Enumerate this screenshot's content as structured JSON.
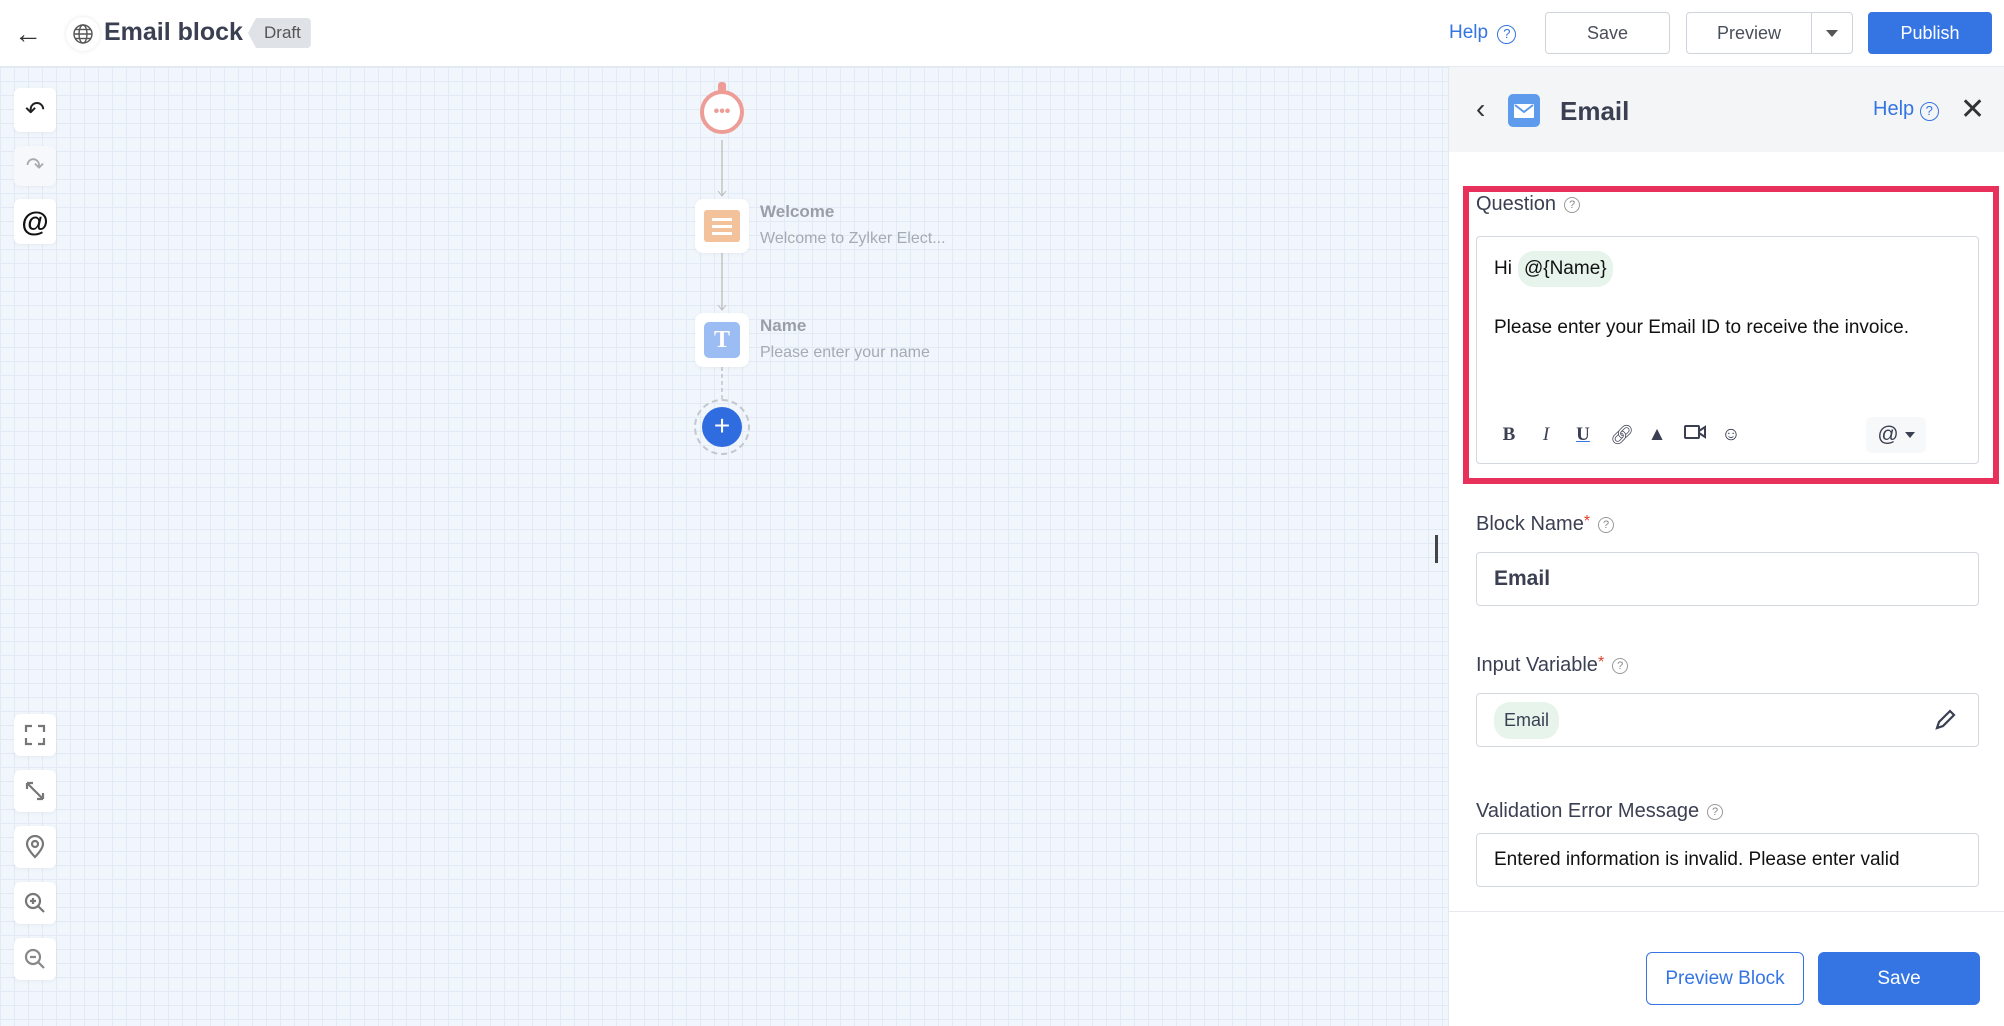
{
  "header": {
    "title": "Email block",
    "status": "Draft",
    "help": "Help",
    "save": "Save",
    "preview": "Preview",
    "publish": "Publish"
  },
  "colors": {
    "accent": "#3574e3",
    "highlight": "#e8315a",
    "chip": "#e6f4ec"
  },
  "flow": {
    "nodes": [
      {
        "title": "Welcome",
        "subtitle": "Welcome to Zylker Elect..."
      },
      {
        "title": "Name",
        "subtitle": "Please enter your name"
      }
    ]
  },
  "panel": {
    "title": "Email",
    "help": "Help",
    "question": {
      "label": "Question",
      "greeting": "Hi",
      "variable": "@{Name}",
      "body": "Please enter your Email ID to receive the invoice.",
      "toolbar": [
        "bold-icon",
        "italic-icon",
        "underline-icon",
        "link-icon",
        "image-icon",
        "video-icon",
        "emoji-icon",
        "mention-icon"
      ]
    },
    "block_name": {
      "label": "Block Name",
      "value": "Email"
    },
    "input_variable": {
      "label": "Input Variable",
      "value": "Email"
    },
    "validation": {
      "label": "Validation Error Message",
      "value": "Entered information is invalid. Please enter valid"
    },
    "preview_block": "Preview Block",
    "save": "Save"
  }
}
